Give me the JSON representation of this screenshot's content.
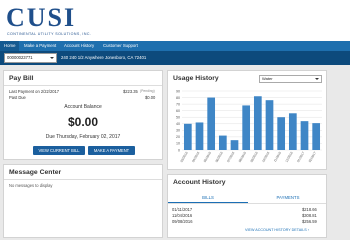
{
  "brand": {
    "logo_text": "CUSI",
    "company_name": "CONTINENTAL UTILITY SOLUTIONS, INC."
  },
  "nav": {
    "items": [
      "Home",
      "Make a Payment",
      "Account History",
      "Customer Support"
    ],
    "active_index": 0
  },
  "account_bar": {
    "account_number": "00000023771",
    "address": "240 240 1/2 Anywhere Jonesboro, CA 72401"
  },
  "pay_bill": {
    "title": "Pay Bill",
    "last_payment_label": "Last Payment on 2/22/2017",
    "last_payment_amount": "$223.35",
    "last_payment_status": "(Pending)",
    "past_due_label": "Past Due",
    "past_due_amount": "$0.00",
    "balance_label": "Account Balance",
    "balance_amount": "$0.00",
    "due_text": "Due Thursday, February 02, 2017",
    "view_bill_button": "VIEW CURRENT BILL",
    "make_payment_button": "MAKE A PAYMENT"
  },
  "message_center": {
    "title": "Message Center",
    "empty_text": "No messages to display"
  },
  "usage_history": {
    "title": "Usage History",
    "utility_select": "Water"
  },
  "chart_data": {
    "type": "bar",
    "categories": [
      "03/2016",
      "04/2016",
      "05/2016",
      "06/2016",
      "07/2016",
      "08/2016",
      "09/2016",
      "10/2016",
      "11/2016",
      "12/2016",
      "01/2017",
      "02/2017"
    ],
    "values": [
      40,
      42,
      80,
      22,
      15,
      68,
      82,
      76,
      50,
      56,
      44,
      41
    ],
    "y_ticks": [
      0,
      10,
      20,
      30,
      40,
      50,
      60,
      70,
      80,
      90
    ],
    "ylim": [
      0,
      90
    ],
    "bar_color": "#3f86c6",
    "grid": true
  },
  "account_history": {
    "title": "Account History",
    "tabs": [
      "BILLS",
      "PAYMENTS"
    ],
    "active_tab": 0,
    "rows": [
      {
        "date": "01/11/2017",
        "amount": "$218.66"
      },
      {
        "date": "11/04/2016",
        "amount": "$308.81"
      },
      {
        "date": "09/08/2016",
        "amount": "$256.59"
      }
    ],
    "details_link": "VIEW ACCOUNT HISTORY DETAILS ›"
  }
}
